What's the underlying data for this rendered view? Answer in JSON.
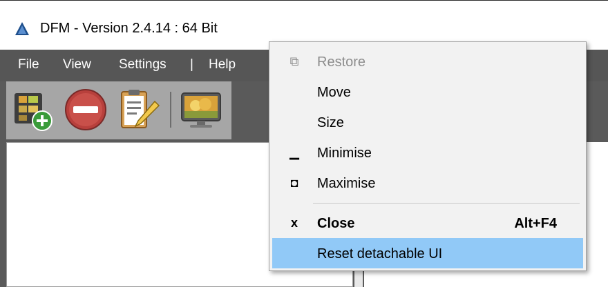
{
  "window": {
    "title": "DFM - Version 2.4.14 : 64 Bit",
    "icon": "dfm-app-icon"
  },
  "menubar": {
    "items": [
      "File",
      "View",
      "Settings",
      "Help"
    ],
    "separator": "|"
  },
  "toolbar": {
    "buttons": [
      {
        "icon": "add-video-icon"
      },
      {
        "icon": "remove-icon"
      },
      {
        "icon": "clipboard-edit-icon"
      },
      {
        "icon": "display-icon"
      }
    ]
  },
  "context_menu": {
    "items": [
      {
        "label": "Restore",
        "icon": "restore-icon",
        "glyph": "⧉",
        "disabled": true
      },
      {
        "label": "Move",
        "icon": "",
        "glyph": ""
      },
      {
        "label": "Size",
        "icon": "",
        "glyph": ""
      },
      {
        "label": "Minimise",
        "icon": "minimise-icon",
        "glyph": "▁"
      },
      {
        "label": "Maximise",
        "icon": "maximise-icon",
        "glyph": "◘"
      },
      {
        "label": "Close",
        "icon": "close-icon",
        "glyph": "x",
        "shortcut": "Alt+F4",
        "bold": true
      },
      {
        "label": "Reset detachable UI",
        "icon": "",
        "glyph": "",
        "highlighted": true
      }
    ]
  },
  "colors": {
    "menubar_bg": "#565656",
    "highlight": "#91c9f7",
    "toolbar_bg": "#a6a6a6"
  }
}
